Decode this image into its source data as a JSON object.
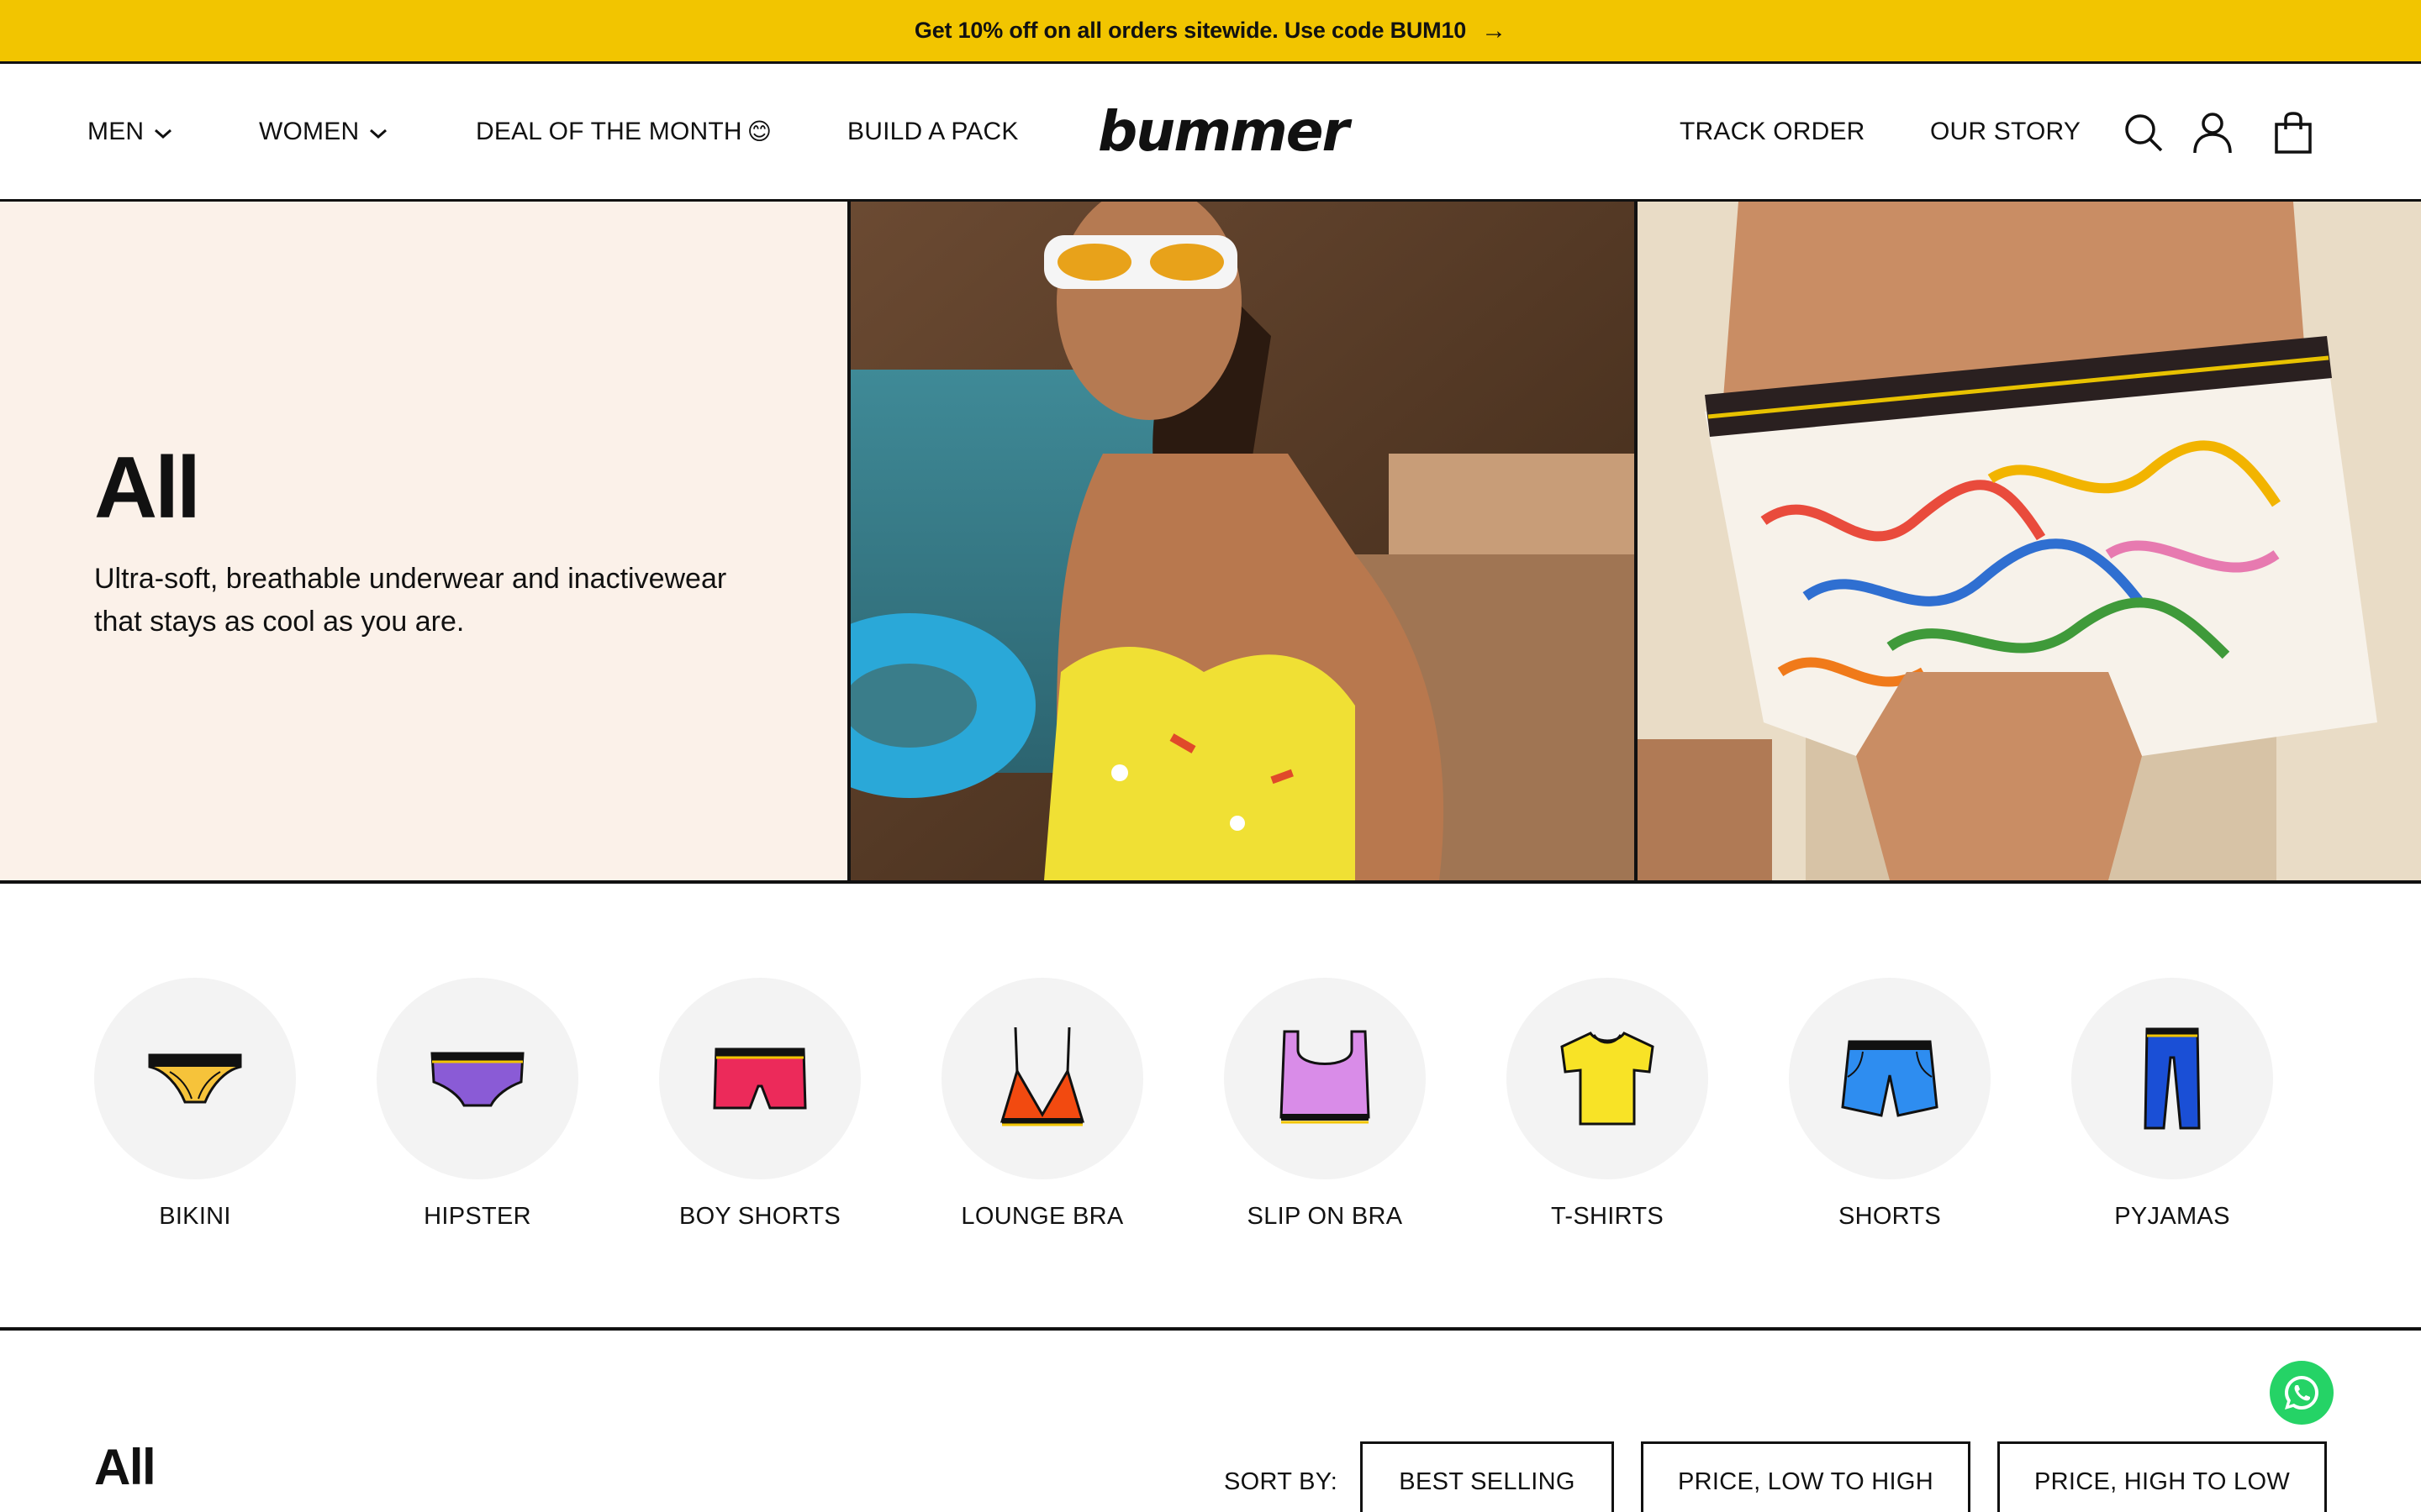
{
  "announcement": {
    "text": "Get 10% off on all orders sitewide. Use code BUM10",
    "arrow": "→"
  },
  "nav": {
    "men": "MEN",
    "women": "WOMEN",
    "deal": "DEAL OF THE MONTH",
    "deal_emoji": "😊",
    "build_pack": "BUILD A PACK",
    "logo": "bummer",
    "track_order": "TRACK ORDER",
    "our_story": "OUR STORY",
    "icons": [
      "search-icon",
      "account-icon",
      "bag-icon"
    ]
  },
  "hero": {
    "title": "All",
    "description": "Ultra-soft, breathable underwear and inactivewear that stays as cool as you are."
  },
  "categories": [
    {
      "label": "BIKINI",
      "icon": "bikini-icon"
    },
    {
      "label": "HIPSTER",
      "icon": "hipster-icon"
    },
    {
      "label": "BOY SHORTS",
      "icon": "boy-shorts-icon"
    },
    {
      "label": "LOUNGE BRA",
      "icon": "lounge-bra-icon"
    },
    {
      "label": "SLIP ON BRA",
      "icon": "slip-on-bra-icon"
    },
    {
      "label": "T-SHIRTS",
      "icon": "tshirt-icon"
    },
    {
      "label": "SHORTS",
      "icon": "shorts-icon"
    },
    {
      "label": "PYJAMAS",
      "icon": "pyjamas-icon"
    }
  ],
  "listing": {
    "title": "All",
    "sort_label": "SORT BY:",
    "sort_options": [
      "BEST SELLING",
      "PRICE, LOW TO HIGH",
      "PRICE, HIGH TO LOW"
    ]
  },
  "colors": {
    "accent": "#f2c500",
    "hero_bg": "#fbf1e9",
    "whatsapp": "#25d366"
  }
}
